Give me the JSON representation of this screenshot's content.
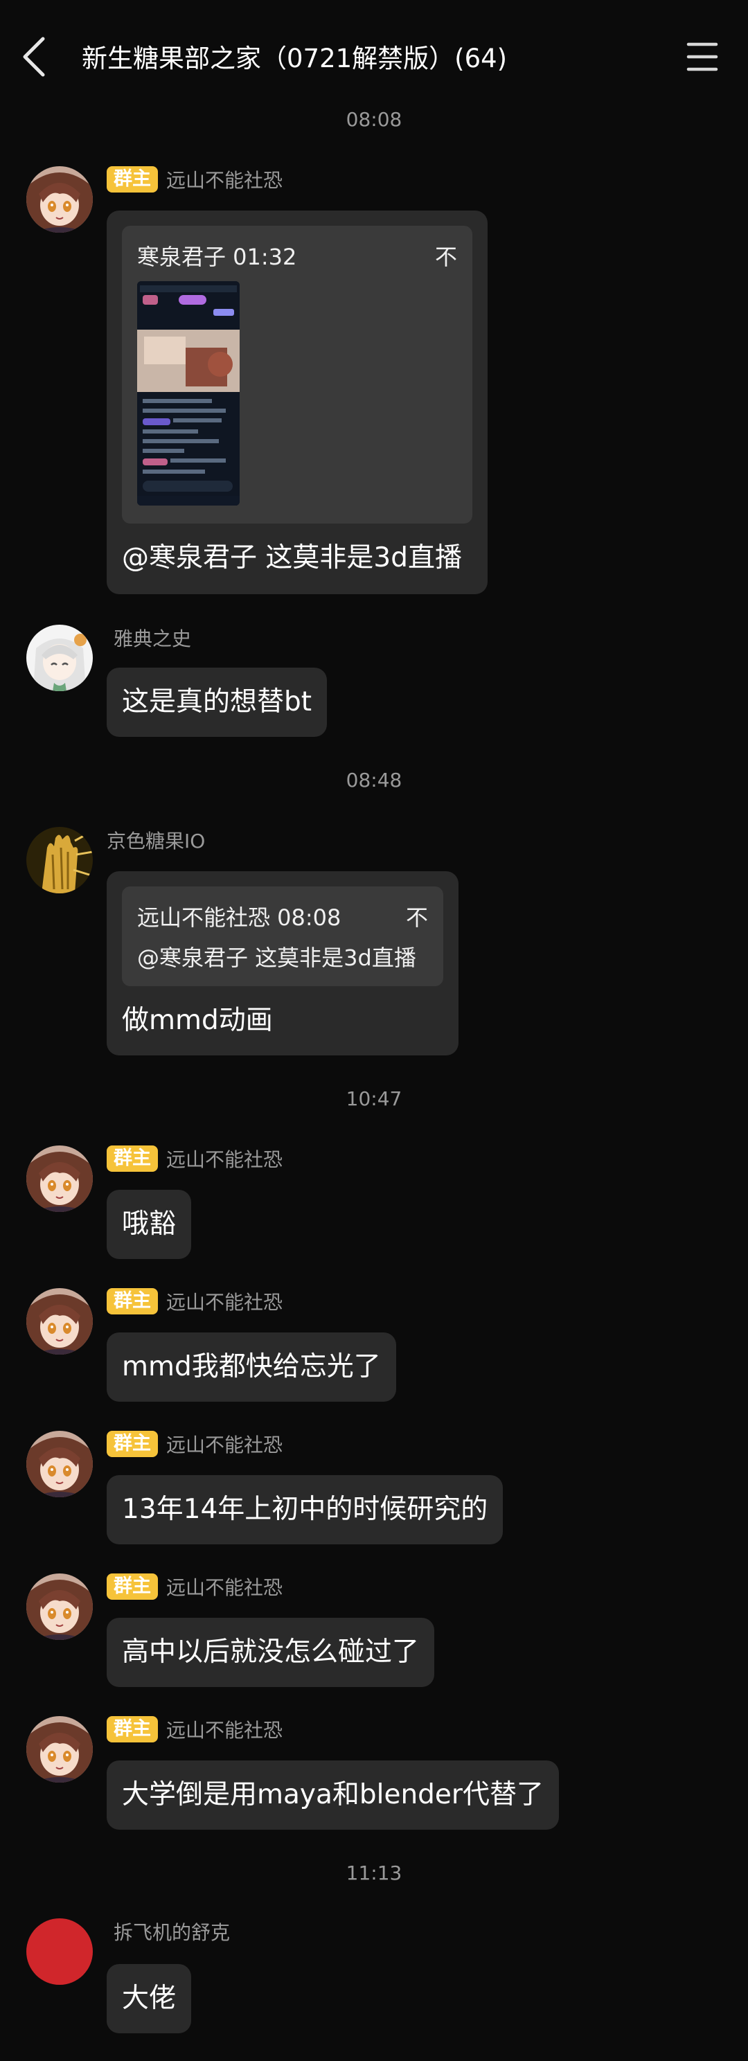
{
  "header": {
    "title": "新生糖果部之家（0721解禁版）(64)"
  },
  "timestamps": {
    "t1": "08:08",
    "t2": "08:48",
    "t3": "10:47",
    "t4": "11:13"
  },
  "messages": {
    "m1": {
      "badge": "群主",
      "sender": "远山不能社恐",
      "quote_header": "寒泉君子 01:32",
      "quote_close": "不",
      "text": "@寒泉君子 这莫非是3d直播"
    },
    "m2": {
      "sender": "雅典之史",
      "text": "这是真的想替bt"
    },
    "m3": {
      "sender": "京色糖果IO",
      "quote_header": "远山不能社恐 08:08",
      "quote_close": "不",
      "quote_text": "@寒泉君子 这莫非是3d直播",
      "text": "做mmd动画"
    },
    "m4": {
      "badge": "群主",
      "sender": "远山不能社恐",
      "text": "哦豁"
    },
    "m5": {
      "badge": "群主",
      "sender": "远山不能社恐",
      "text": "mmd我都快给忘光了"
    },
    "m6": {
      "badge": "群主",
      "sender": "远山不能社恐",
      "text": "13年14年上初中的时候研究的"
    },
    "m7": {
      "badge": "群主",
      "sender": "远山不能社恐",
      "text": "高中以后就没怎么碰过了"
    },
    "m8": {
      "badge": "群主",
      "sender": "远山不能社恐",
      "text": "大学倒是用maya和blender代替了"
    },
    "m9": {
      "sender": "拆飞机的舒克",
      "text": "大佬"
    }
  },
  "colors": {
    "badge": "#f6c33a",
    "bubble": "#2a2a2a",
    "quote": "#3a3a3a",
    "background": "#0b0b0b",
    "red_avatar": "#d0262b"
  },
  "icons": {
    "back": "chevron-left-icon",
    "menu": "hamburger-menu-icon"
  }
}
